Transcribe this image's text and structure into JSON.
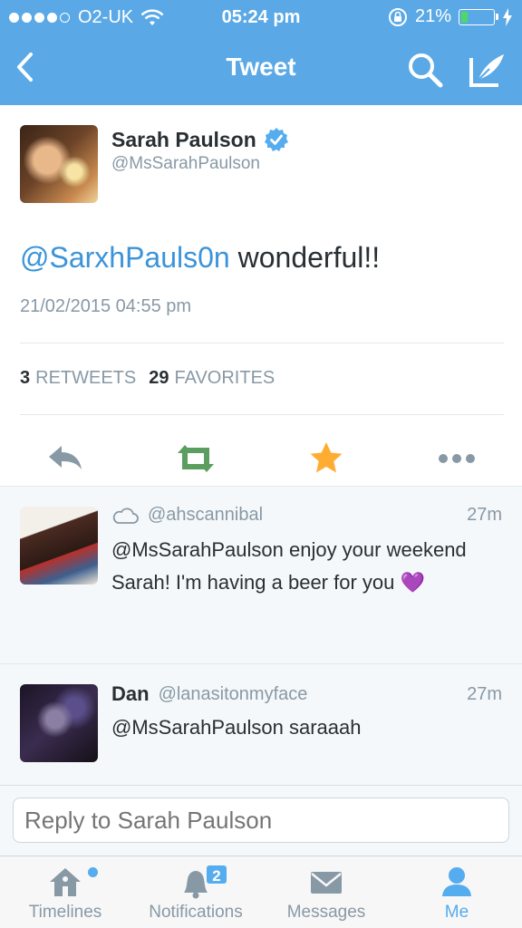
{
  "status_bar": {
    "carrier": "O2-UK",
    "time": "05:24 pm",
    "battery": "21%",
    "battery_level": 0.21,
    "signal_bars": 4
  },
  "nav": {
    "title": "Tweet",
    "icons": [
      "back-chevron-icon",
      "search-icon",
      "compose-icon"
    ]
  },
  "tweet": {
    "author_name": "Sarah Paulson",
    "author_handle": "@MsSarahPaulson",
    "verified": true,
    "mention": "@SarxhPauls0n",
    "text": " wonderful!!",
    "timestamp": "21/02/2015 04:55 pm",
    "retweets_count": "3",
    "retweets_label": "RETWEETS",
    "favorites_count": "29",
    "favorites_label": "FAVORITES",
    "actions": [
      "reply-icon",
      "retweet-icon",
      "favorite-star-icon",
      "more-icon"
    ],
    "colors": {
      "retweet": "#5c9e5f",
      "favorite": "#ffac33",
      "link": "#3b94d9"
    }
  },
  "replies": [
    {
      "name": "",
      "handle": "@ahscannibal",
      "time": "27m",
      "text": "@MsSarahPaulson enjoy your weekend Sarah! I'm having a beer for you",
      "emoji": "💜"
    },
    {
      "name": "Dan",
      "handle": "@lanasitonmyface",
      "time": "27m",
      "text": "@MsSarahPaulson saraaah"
    }
  ],
  "reply_box": {
    "placeholder": "Reply to Sarah Paulson"
  },
  "tabbar": {
    "items": [
      {
        "label": "Timelines",
        "icon": "home-icon",
        "active": false,
        "dot": true
      },
      {
        "label": "Notifications",
        "icon": "bell-icon",
        "active": false,
        "badge": "2"
      },
      {
        "label": "Messages",
        "icon": "envelope-icon",
        "active": false
      },
      {
        "label": "Me",
        "icon": "person-icon",
        "active": true
      }
    ],
    "accent": "#55acee"
  }
}
